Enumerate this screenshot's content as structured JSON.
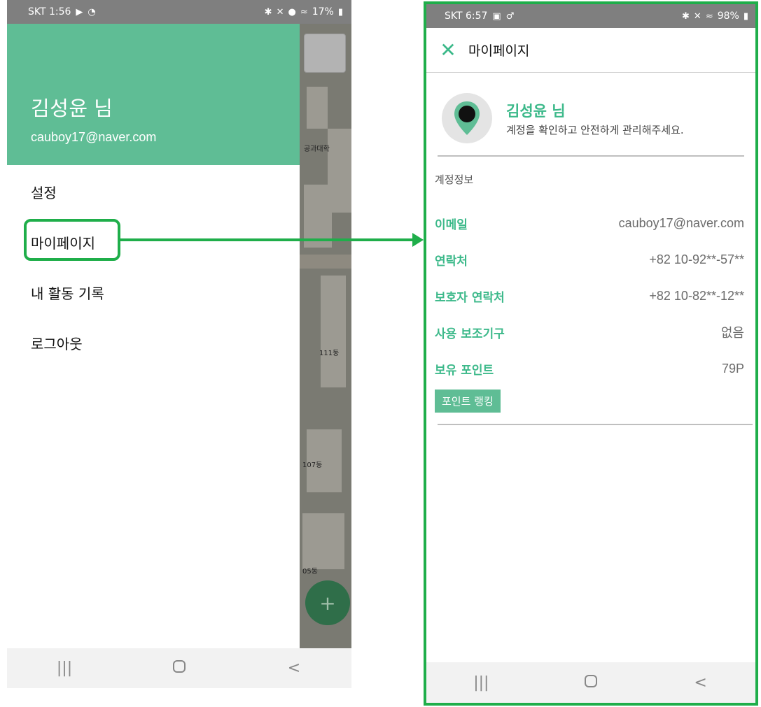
{
  "left": {
    "status": {
      "carrier_time": "SKT 1:56",
      "battery": "17%"
    },
    "drawer": {
      "name": "김성윤 님",
      "email": "cauboy17@naver.com",
      "menu": [
        "설정",
        "마이페이지",
        "내 활동 기록",
        "로그아웃"
      ]
    },
    "map_labels": [
      "공과대학",
      "111동",
      "107동",
      "05동"
    ]
  },
  "right": {
    "status": {
      "carrier_time": "SKT 6:57",
      "battery": "98%"
    },
    "title": "마이페이지",
    "profile": {
      "name": "김성윤 님",
      "subtitle": "계정을 확인하고 안전하게 관리해주세요."
    },
    "section_title": "계정정보",
    "rows": [
      {
        "label": "이메일",
        "value": "cauboy17@naver.com"
      },
      {
        "label": "연락처",
        "value": "+82 10-92**-57**"
      },
      {
        "label": "보호자 연락처",
        "value": "+82 10-82**-12**"
      },
      {
        "label": "사용 보조기구",
        "value": "없음"
      },
      {
        "label": "보유 포인트",
        "value": "79P"
      }
    ],
    "rank_button": "포인트 랭킹"
  },
  "colors": {
    "accent": "#5fbd95",
    "label": "#3cb98a",
    "highlight": "#1fae4a"
  }
}
